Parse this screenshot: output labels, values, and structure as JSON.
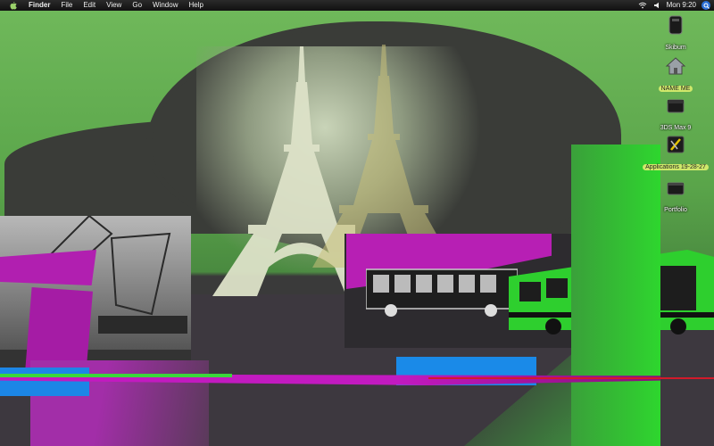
{
  "menubar": {
    "app_name": "Finder",
    "items": [
      "File",
      "Edit",
      "View",
      "Go",
      "Window",
      "Help"
    ],
    "clock": "Mon 9:20"
  },
  "desktop": {
    "icons": [
      {
        "label": "Skibum",
        "icon": "hard-drive-icon",
        "highlighted": false
      },
      {
        "label": "NAME ME",
        "icon": "home-folder-icon",
        "highlighted": true
      },
      {
        "label": "3DS Max 9",
        "icon": "disk-image-icon",
        "highlighted": false
      },
      {
        "label": "Applications 19-28-27",
        "icon": "applications-folder-icon",
        "highlighted": true
      },
      {
        "label": "Portfolio",
        "icon": "drive-icon",
        "highlighted": false
      }
    ]
  },
  "colors": {
    "menubar": "#1a1a1a",
    "wallpaper_green": "#5aa54a",
    "magenta": "#b71fb4",
    "blue": "#1a8ae8",
    "label_highlight": "#cfe86a"
  }
}
